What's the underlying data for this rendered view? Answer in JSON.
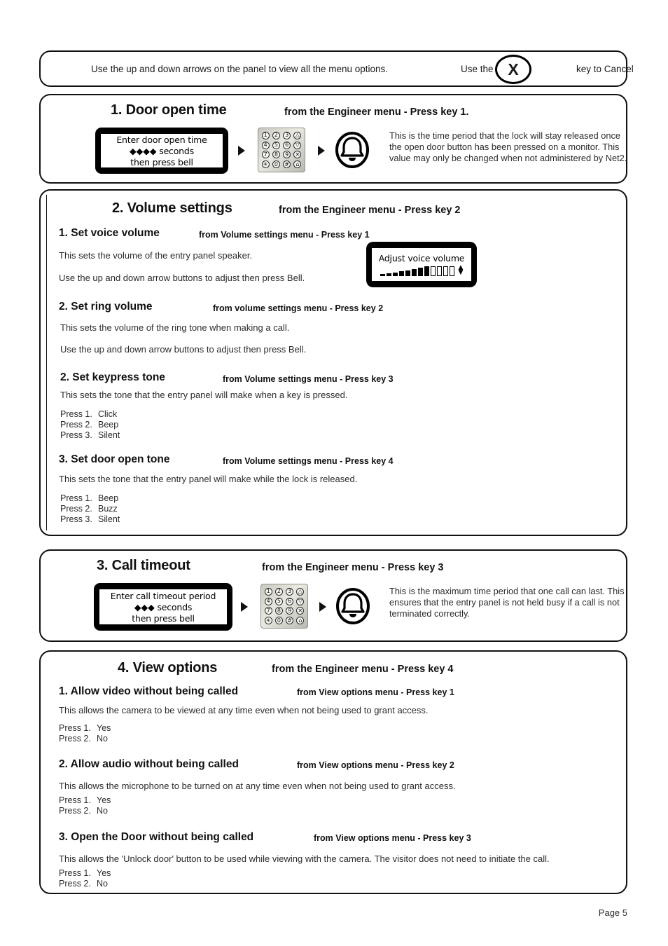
{
  "footer": {
    "page_label": "Page 5"
  },
  "note": {
    "main": "Use the up and down arrows on the panel to view all the menu options.",
    "use_the": "Use the",
    "key_glyph": "X",
    "key_to_cancel": "key to Cancel"
  },
  "keypad": {
    "keys": [
      "1",
      "2",
      "3",
      "△",
      "4",
      "5",
      "6",
      "▽",
      "7",
      "8",
      "9",
      "✕",
      "✳",
      "0",
      "#",
      "⌂"
    ]
  },
  "sections": [
    {
      "title": "1. Door open time",
      "from": "from the Engineer menu - Press key 1.",
      "lcd": {
        "line1": "Enter door open time",
        "line2_diamonds": "◆◆◆◆",
        "line2_rest": " seconds",
        "line3": "then press bell"
      },
      "description": "This is the time period that the lock will stay released once the open door button has been pressed on a monitor. This value may only be changed when not administered by Net2."
    },
    {
      "title": "2. Volume settings",
      "from": "from the Engineer menu - Press key 2",
      "subsections": [
        {
          "title": "1. Set voice volume",
          "from": "from Volume settings menu - Press key 1",
          "body1": "This sets the volume of the entry panel speaker.",
          "body2": "Use the up and down arrow buttons to adjust then press Bell.",
          "lcd_label": "Adjust voice volume"
        },
        {
          "title": "2. Set ring volume",
          "from": "from volume settings menu - Press key 2",
          "body1": "This sets the volume of the ring tone when making a call.",
          "body2": "Use the up and down arrow buttons to adjust then press Bell."
        },
        {
          "title": "2. Set keypress tone",
          "from": "from Volume settings menu - Press key 3",
          "body1": "This sets the tone that the entry panel will make when a key is pressed.",
          "options": [
            {
              "label": "Press 1.",
              "value": "Click"
            },
            {
              "label": "Press 2.",
              "value": "Beep"
            },
            {
              "label": "Press 3.",
              "value": "Silent"
            }
          ]
        },
        {
          "title": "3. Set door open tone",
          "from": "from Volume settings menu - Press key 4",
          "body1": "This sets the tone that the entry panel will make while the lock is released.",
          "options": [
            {
              "label": "Press 1.",
              "value": "Beep"
            },
            {
              "label": "Press 2.",
              "value": "Buzz"
            },
            {
              "label": "Press 3.",
              "value": "Silent"
            }
          ]
        }
      ]
    },
    {
      "title": "3. Call timeout",
      "from": "from the Engineer menu - Press key 3",
      "lcd": {
        "line1": "Enter call timeout period",
        "line2_diamonds": "◆◆◆",
        "line2_rest": " seconds",
        "line3": "then press bell"
      },
      "description": "This is the maximum time period that one call can last. This ensures that the entry panel is not held busy if a call is not terminated correctly."
    },
    {
      "title": "4. View options",
      "from": "from the Engineer menu - Press key 4",
      "subsections": [
        {
          "title": "1. Allow video without being called",
          "from": "from View options menu - Press key 1",
          "body1": "This allows the camera to be viewed at any time even when not being used to grant access.",
          "options": [
            {
              "label": "Press 1.",
              "value": "Yes"
            },
            {
              "label": "Press 2.",
              "value": "No"
            }
          ]
        },
        {
          "title": "2. Allow audio without being called",
          "from": "from View options menu - Press key 2",
          "body1": "This allows the microphone to be turned on at any time even when not being used to grant access.",
          "options": [
            {
              "label": "Press 1.",
              "value": "Yes"
            },
            {
              "label": "Press 2.",
              "value": "No"
            }
          ]
        },
        {
          "title": "3. Open the Door without being called",
          "from": "from View options menu - Press key 3",
          "body1": "This allows the 'Unlock door' button to be used while viewing with the camera. The visitor does not need to initiate the call.",
          "options": [
            {
              "label": "Press 1.",
              "value": "Yes"
            },
            {
              "label": "Press 2.",
              "value": "No"
            }
          ]
        }
      ]
    }
  ],
  "volume_meter": {
    "filled_heights": [
      3,
      4,
      5,
      7,
      8,
      10,
      12,
      14
    ],
    "empty_count": 4,
    "up_glyph": "▲",
    "down_glyph": "▼"
  }
}
